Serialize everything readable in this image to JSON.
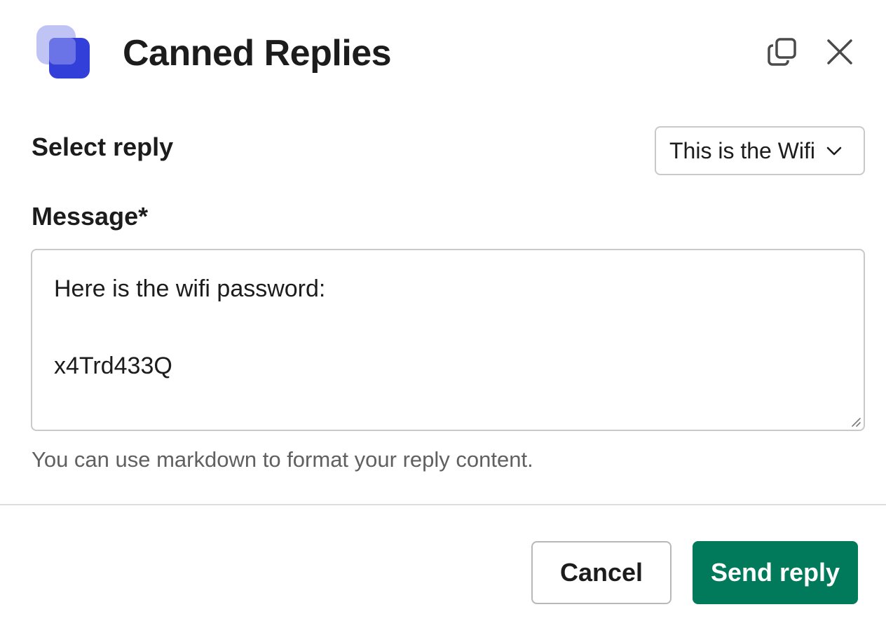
{
  "header": {
    "title": "Canned Replies",
    "app_icon": "canned-replies-app-icon",
    "popout_icon": "popout-icon",
    "close_icon": "close-icon"
  },
  "form": {
    "select_reply": {
      "label": "Select reply",
      "selected_value": "This is the Wifi"
    },
    "message": {
      "label": "Message*",
      "lines": [
        "Here is the wifi password:",
        "",
        "x4Trd433Q",
        ""
      ]
    },
    "hint": "You can use markdown to format your reply content."
  },
  "footer": {
    "cancel_label": "Cancel",
    "send_label": "Send reply"
  },
  "colors": {
    "primary_button": "#007a5a",
    "app_icon_blue": "#3240d9",
    "app_icon_light": "#a9b0f2"
  }
}
